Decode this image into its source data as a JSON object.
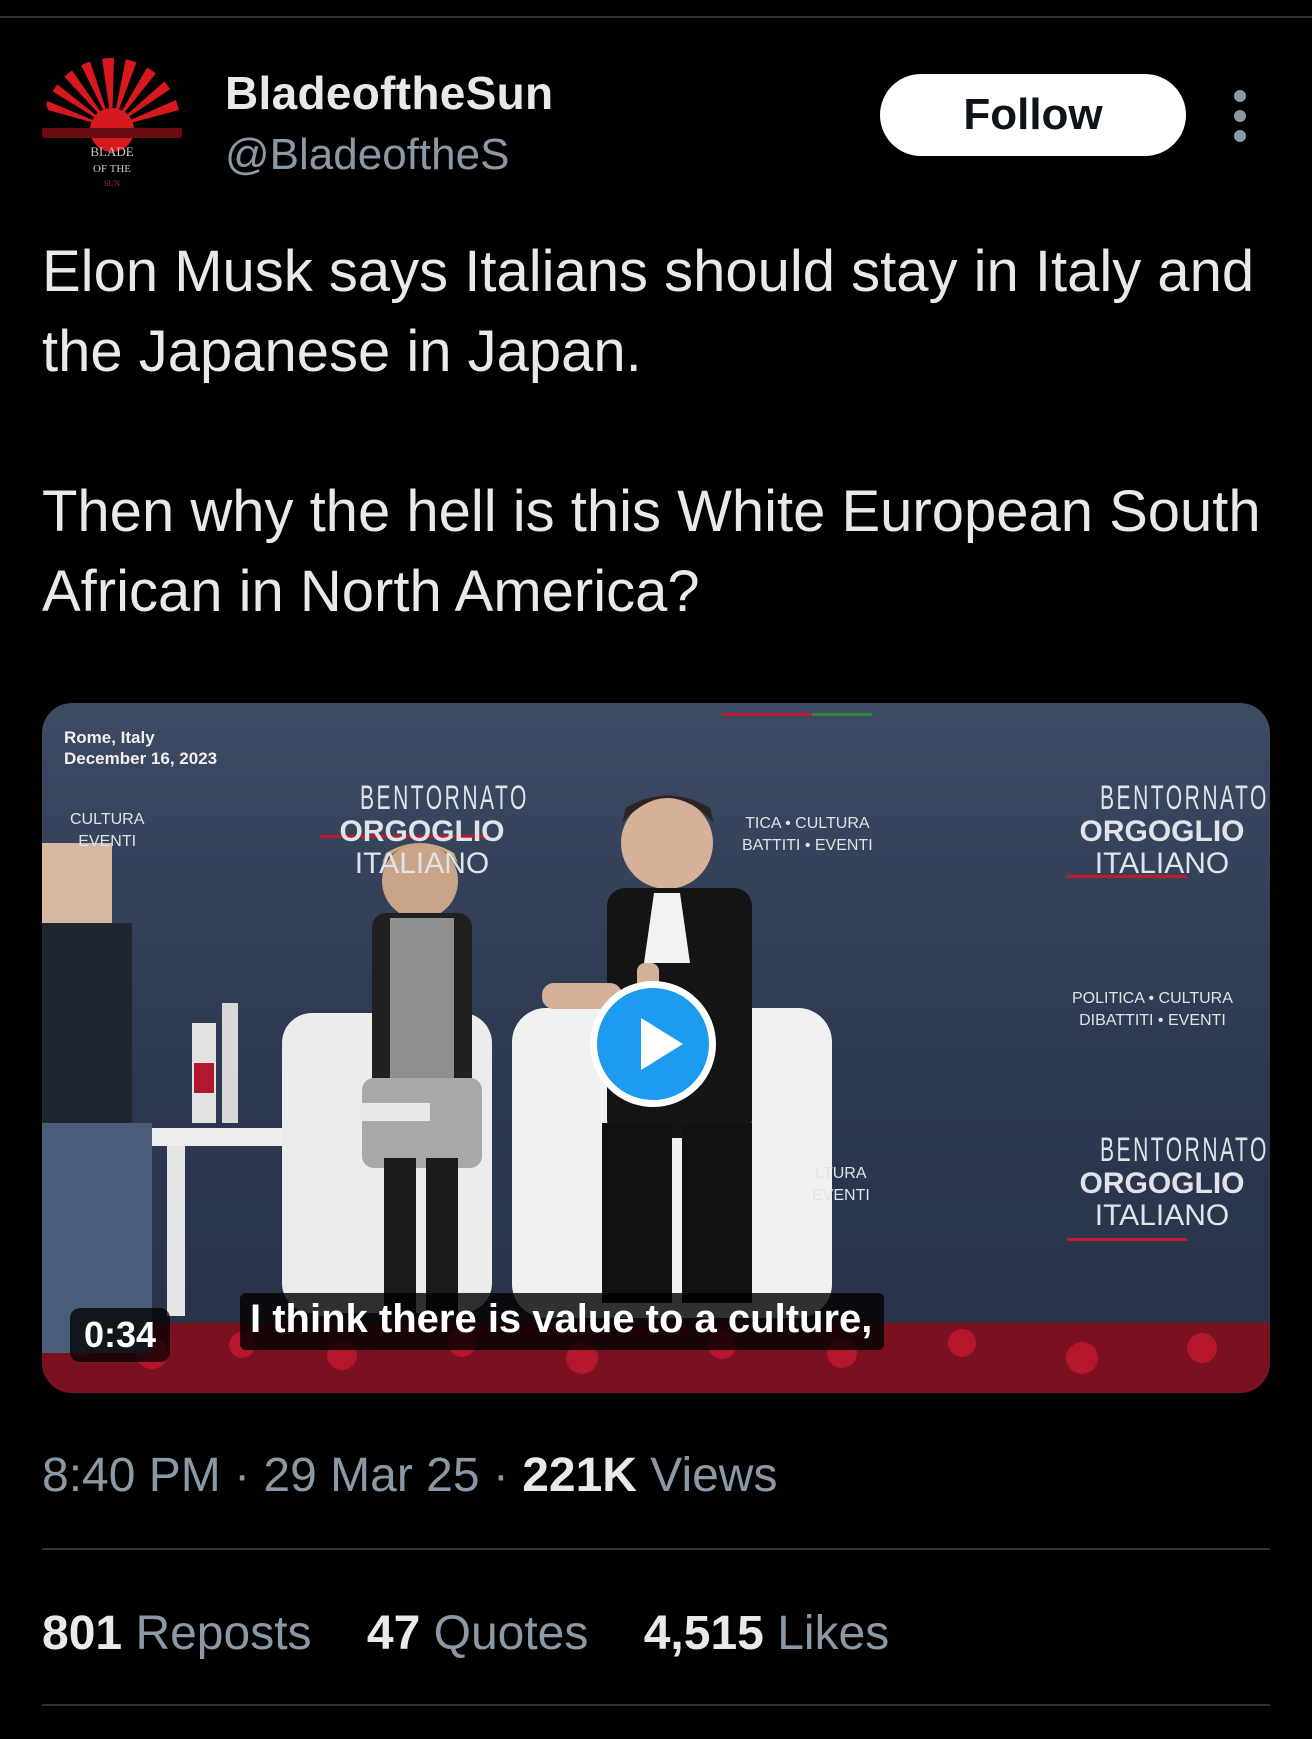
{
  "author": {
    "name": "BladeoftheSun",
    "handle": "@BladeoftheS",
    "avatar_text": "BLADE OF THE SUN",
    "follow_label": "Follow"
  },
  "tweet": {
    "text": "Elon Musk says Italians should stay in Italy and the Japanese in Japan.\n\nThen why the hell is this White European South African in North America?"
  },
  "media": {
    "location_line1": "Rome, Italy",
    "location_line2": "December 16, 2023",
    "duration": "0:34",
    "caption": "I think there is value to a culture,",
    "wall_logos": [
      {
        "l1": "BENTORNATO",
        "l2": "ORGOGLIO",
        "l3": "ITALIANO"
      },
      {
        "l1": "BENTORNATO",
        "l2": "ORGOGLIO",
        "l3": "ITALIANO"
      },
      {
        "l1": "BENTORNATO",
        "l2": "ORGOGLIO",
        "l3": "ITALIANO"
      }
    ],
    "wall_small": {
      "a1": "CULTURA",
      "a2": "EVENTI",
      "b1": "TICA • CULTURA",
      "b2": "BATTITI • EVENTI",
      "c1": "POLITICA • CULTURA",
      "c2": "DIBATTITI • EVENTI",
      "d1": "LTURA",
      "d2": "EVENTI"
    }
  },
  "meta": {
    "time": "8:40 PM",
    "sep": " · ",
    "date": "29 Mar 25",
    "views_count": "221K",
    "views_label": "Views"
  },
  "stats": [
    {
      "count": "801",
      "label": "Reposts"
    },
    {
      "count": "47",
      "label": "Quotes"
    },
    {
      "count": "4,515",
      "label": "Likes"
    }
  ],
  "colors": {
    "background": "#000000",
    "text": "#e7e9ea",
    "muted": "#8b98a5",
    "accent": "#1d9bf0",
    "divider": "#2f3336"
  }
}
